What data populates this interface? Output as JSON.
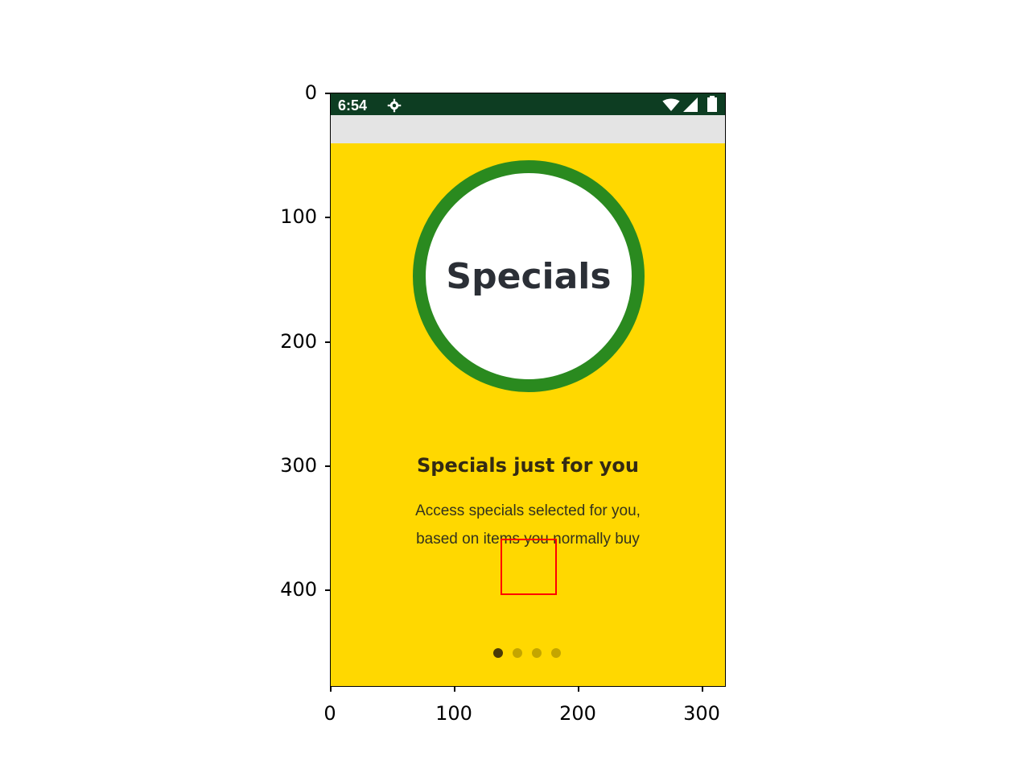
{
  "status_bar": {
    "time": "6:54",
    "icons": [
      "gear-icon",
      "wifi-icon",
      "signal-icon",
      "battery-icon"
    ],
    "background": "#0d3d22"
  },
  "onboarding": {
    "badge_text": "Specials",
    "headline": "Specials just for you",
    "body_line_1": "Access specials selected for you,",
    "body_line_2": "based on items you normally buy",
    "pager": {
      "total": 4,
      "active_index": 0
    },
    "colors": {
      "background": "#ffd800",
      "ring": "#2a8a1f",
      "dot_active": "#4a3a07",
      "dot_inactive": "#c4a500"
    }
  },
  "axes": {
    "y_ticks": [
      "0",
      "100",
      "200",
      "300",
      "400"
    ],
    "x_ticks": [
      "0",
      "100",
      "200",
      "300"
    ]
  }
}
